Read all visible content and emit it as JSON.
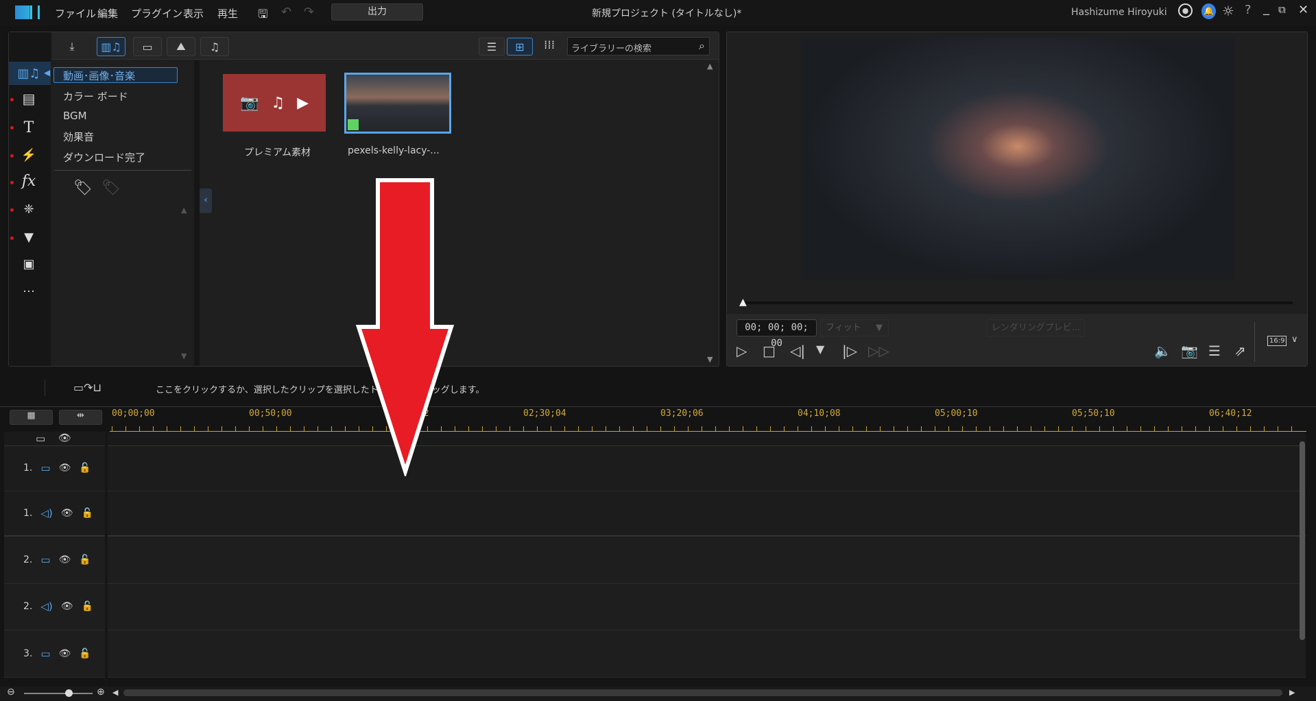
{
  "menu": {
    "items": [
      "ファイル",
      "編集",
      "プラグイン",
      "表示",
      "再生"
    ],
    "output": "出力"
  },
  "window": {
    "title": "新規プロジェクト (タイトルなし)*",
    "user": "Hashizume Hiroyuki"
  },
  "library": {
    "search_placeholder": "ライブラリーの検索",
    "categories": [
      "動画･画像･音楽",
      "カラー ボード",
      "BGM",
      "効果音",
      "ダウンロード完了"
    ],
    "items": [
      {
        "label": "プレミアム素材"
      },
      {
        "label": "pexels-kelly-lacy-..."
      }
    ]
  },
  "preview": {
    "timecode": "00; 00; 00; 00",
    "fit": "フィット",
    "render": "レンダリングプレビ...",
    "aspect": "16:9"
  },
  "timeline": {
    "instruction": "ここをクリックするか、選択したクリップを選択したトラックにドラッグします。",
    "ruler": [
      "00;00;00",
      "00;50;00",
      "01;40;02",
      "02;30;04",
      "03;20;06",
      "04;10;08",
      "05;00;10",
      "05;50;10",
      "06;40;12"
    ],
    "tracks": [
      {
        "num": "1.",
        "type": "video"
      },
      {
        "num": "1.",
        "type": "audio"
      },
      {
        "num": "2.",
        "type": "video"
      },
      {
        "num": "2.",
        "type": "audio"
      },
      {
        "num": "3.",
        "type": "video"
      }
    ]
  },
  "colors": {
    "accent": "#3d84c6",
    "premium": "#9b3533",
    "ruler": "#d4a937",
    "arrow": "#e81c24"
  }
}
